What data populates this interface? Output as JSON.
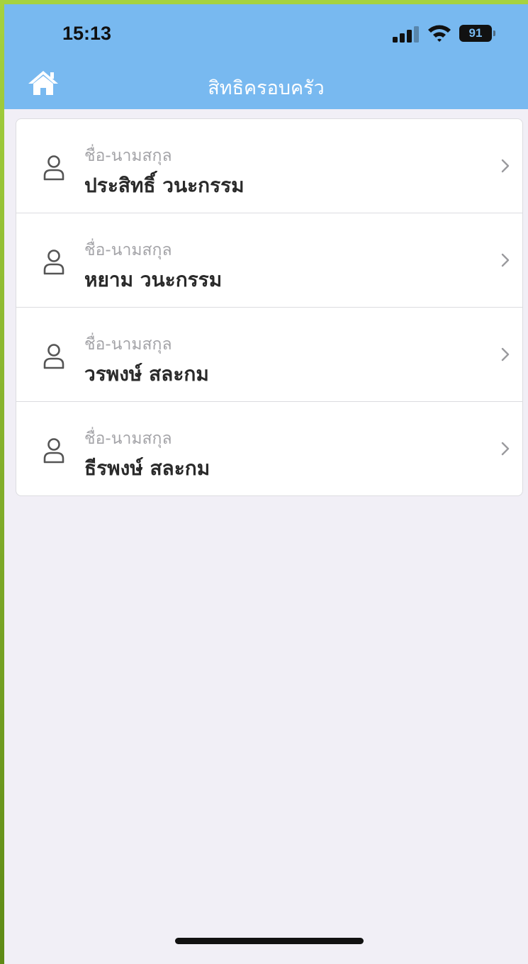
{
  "status_bar": {
    "time": "15:13",
    "battery": "91"
  },
  "nav": {
    "title": "สิทธิครอบครัว",
    "home_icon": "home-icon"
  },
  "members": [
    {
      "label": "ชื่อ-นามสกุล",
      "name": "ประสิทธิ์ วนะกรรม"
    },
    {
      "label": "ชื่อ-นามสกุล",
      "name": "หยาม วนะกรรม"
    },
    {
      "label": "ชื่อ-นามสกุล",
      "name": "วรพงษ์ สละกม"
    },
    {
      "label": "ชื่อ-นามสกุล",
      "name": "ธีรพงษ์ สละกม"
    }
  ],
  "colors": {
    "header": "#78b9f0",
    "background": "#f1eff6",
    "card": "#ffffff"
  }
}
